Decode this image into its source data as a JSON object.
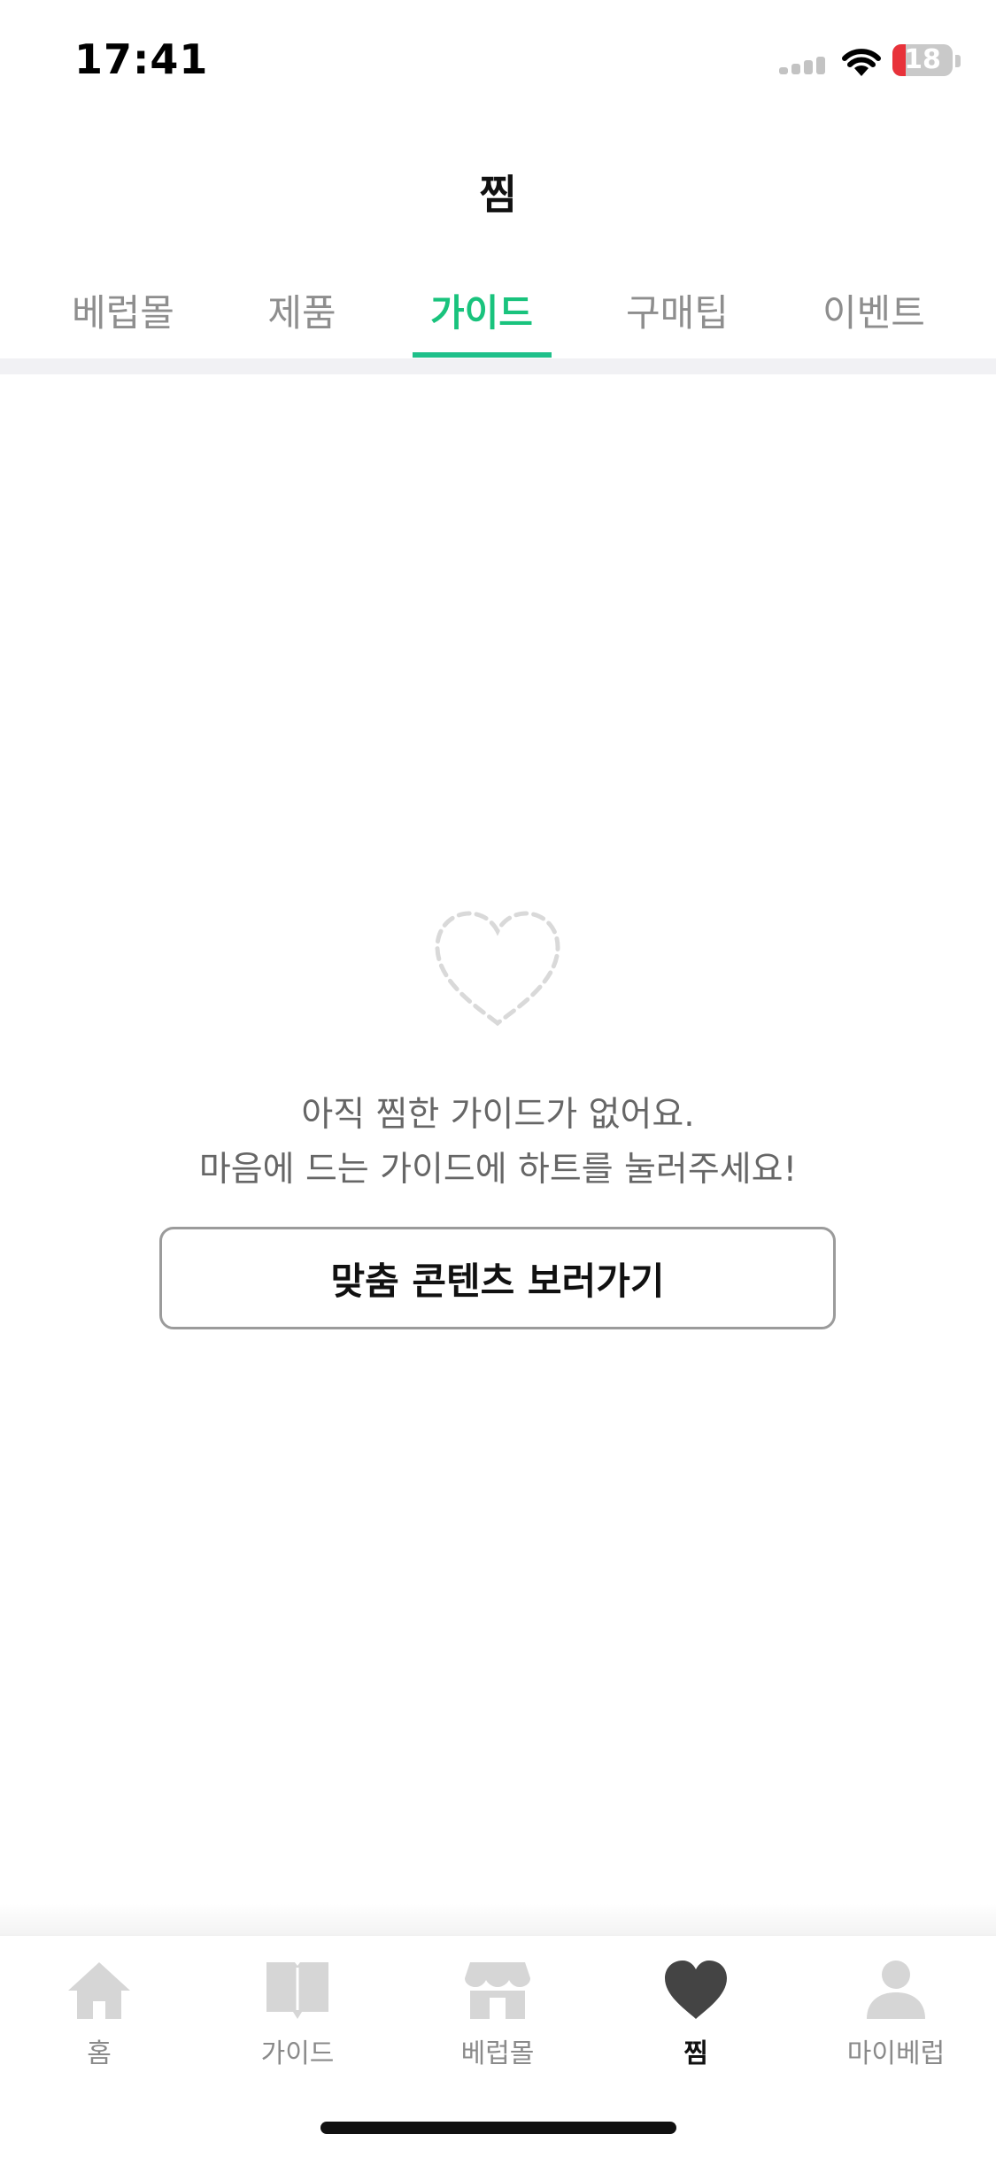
{
  "status_bar": {
    "time": "17:41",
    "battery_level": "18",
    "signal_icon": "cellular-signal-icon",
    "wifi_icon": "wifi-icon",
    "battery_icon": "battery-icon"
  },
  "header": {
    "title": "찜"
  },
  "tabs": [
    {
      "label": "베럽몰",
      "active": false
    },
    {
      "label": "제품",
      "active": false
    },
    {
      "label": "가이드",
      "active": true
    },
    {
      "label": "구매팁",
      "active": false
    },
    {
      "label": "이벤트",
      "active": false
    }
  ],
  "empty_state": {
    "icon": "dashed-heart-icon",
    "message_line1": "아직 찜한 가이드가 없어요.",
    "message_line2": "마음에 드는 가이드에 하트를 눌러주세요!",
    "button_label": "맞춤 콘텐츠 보러가기"
  },
  "bottom_nav": [
    {
      "label": "홈",
      "icon": "home-icon",
      "active": false
    },
    {
      "label": "가이드",
      "icon": "book-icon",
      "active": false
    },
    {
      "label": "베럽몰",
      "icon": "store-icon",
      "active": false
    },
    {
      "label": "찜",
      "icon": "heart-icon",
      "active": true
    },
    {
      "label": "마이베럽",
      "icon": "person-icon",
      "active": false
    }
  ],
  "colors": {
    "accent": "#1fc08a",
    "inactive_text": "#8e8e8e",
    "inactive_icon": "#d6d6d6",
    "active_icon": "#444444"
  }
}
